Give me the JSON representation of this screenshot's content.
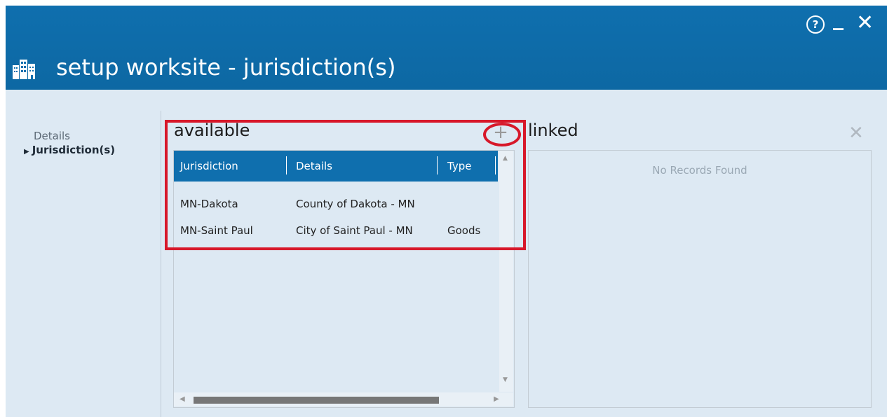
{
  "header": {
    "title": "setup worksite - jurisdiction(s)",
    "help_label": "?",
    "minimize_label": "_",
    "close_label": "✕"
  },
  "nav": {
    "items": [
      {
        "label": "Details"
      },
      {
        "label": "Jurisdiction(s)"
      }
    ]
  },
  "available": {
    "title": "available",
    "add_label": "+",
    "columns": [
      "Jurisdiction",
      "Details",
      "Type"
    ],
    "rows": [
      {
        "jurisdiction": "MN-Dakota",
        "details": "County of Dakota - MN",
        "type": ""
      },
      {
        "jurisdiction": "MN-Saint Paul",
        "details": "City of Saint Paul - MN",
        "type": "Goods"
      }
    ]
  },
  "linked": {
    "title": "linked",
    "clear_label": "✕",
    "empty_text": "No Records Found"
  },
  "colors": {
    "header_bg": "#0f6fae",
    "content_bg": "#dde9f3",
    "highlight": "#d7182a"
  }
}
